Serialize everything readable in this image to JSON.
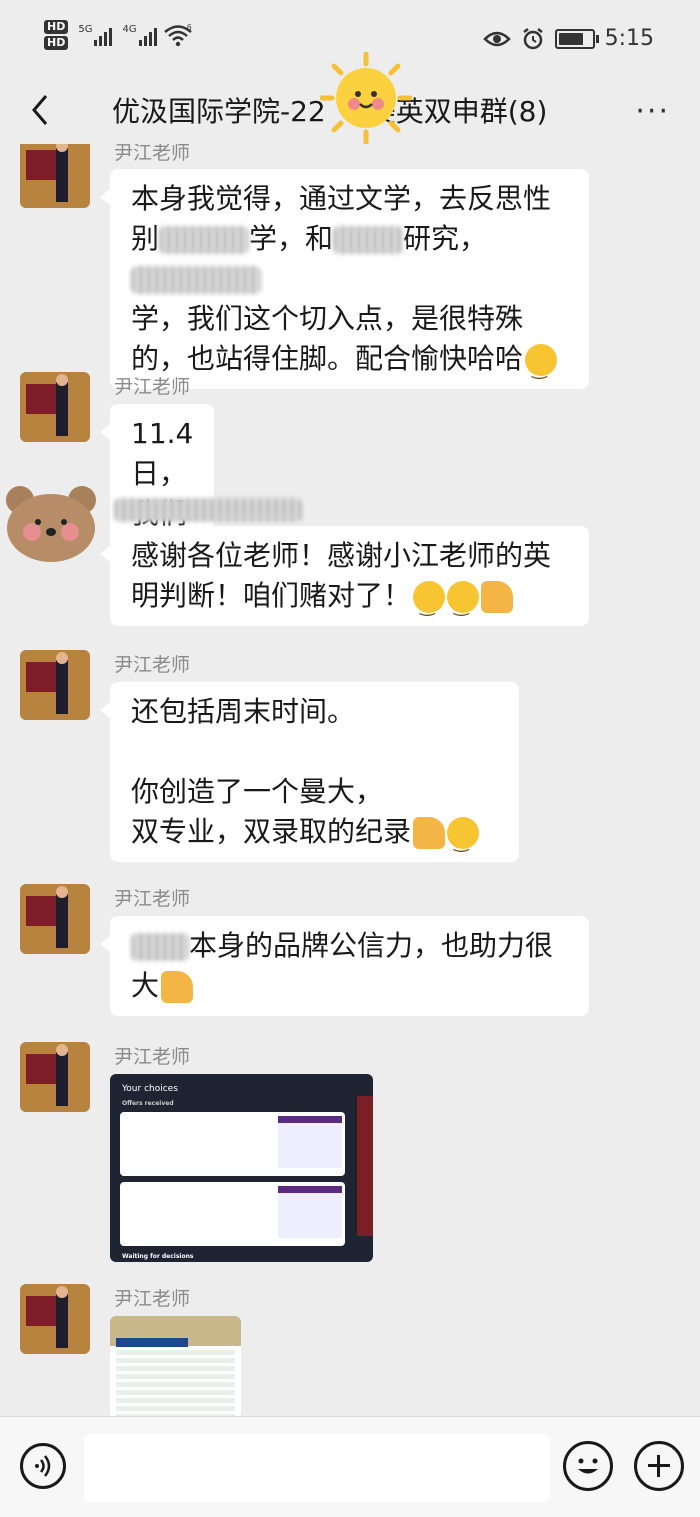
{
  "status_bar": {
    "hd1": "HD",
    "hd2": "HD",
    "net1": "5G",
    "net2": "4G",
    "wifi_label": "6",
    "time": "5:15"
  },
  "nav": {
    "title": "优汲国际学院-22",
    "title_tail": "美英双申群(8)",
    "more_label": "···"
  },
  "messages": [
    {
      "sender": "尹江老师",
      "text_a": "本身我觉得，通过文学，去反思性\n别",
      "text_b": "学，和",
      "text_c": "研究，",
      "text_d": "\n学，我们这个切入点，是很特殊\n的，也站得住脚。配合愉快哈哈"
    },
    {
      "sender": "尹江老师",
      "text": "11.4 日，我们提交"
    },
    {
      "sender": "",
      "text": "感谢各位老师！感谢小江老师的英\n明判断！咱们赌对了！"
    },
    {
      "sender": "尹江老师",
      "text": "还包括周末时间。\n\n你创造了一个曼大，\n双专业，双录取的纪录"
    },
    {
      "sender": "尹江老师",
      "text_a": "本身的品牌公信力，也助力很\n大"
    },
    {
      "sender": "尹江老师",
      "image": {
        "heading": "Your choices",
        "subheading": "Offers received",
        "footer": "Waiting for decisions"
      }
    },
    {
      "sender": "尹江老师"
    }
  ],
  "input_bar": {
    "placeholder": ""
  }
}
